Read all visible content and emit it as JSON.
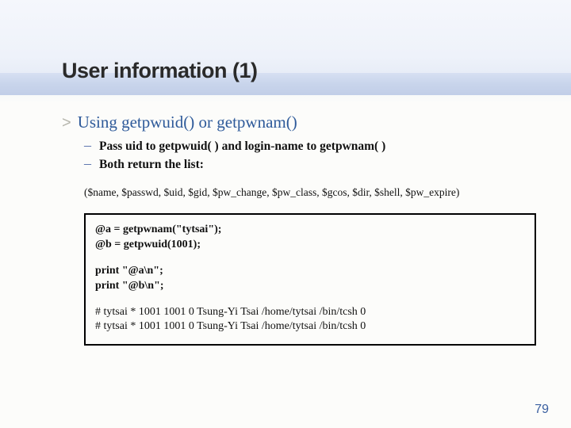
{
  "title": "User information (1)",
  "section": {
    "chevron": ">",
    "heading": "Using getpwuid() or getpwnam()",
    "bullets": [
      "Pass uid to getpwuid( ) and login-name to getpwnam( )",
      "Both return the list:"
    ]
  },
  "fields_line": "($name, $passwd, $uid, $gid, $pw_change, $pw_class, $gcos, $dir, $shell, $pw_expire)",
  "code": {
    "l1": "@a = getpwnam(\"tytsai\");",
    "l2": "@b = getpwuid(1001);",
    "l3": "print \"@a\\n\";",
    "l4": "print \"@b\\n\";",
    "o1": "# tytsai * 1001 1001 0  Tsung-Yi Tsai /home/tytsai /bin/tcsh 0",
    "o2": "# tytsai * 1001 1001 0  Tsung-Yi Tsai /home/tytsai /bin/tcsh 0"
  },
  "page_number": "79"
}
